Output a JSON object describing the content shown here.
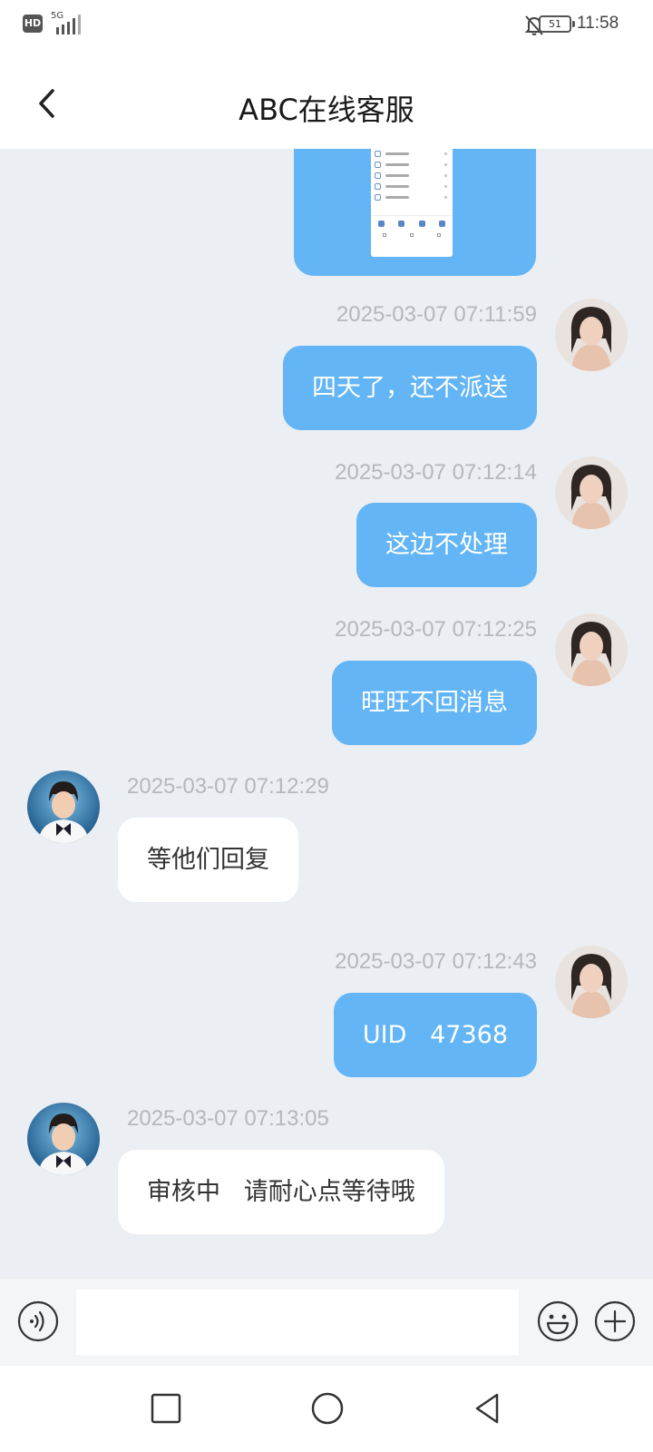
{
  "status_bar": {
    "hd": "HD",
    "network": "5G",
    "battery": "51",
    "time": "11:58"
  },
  "header": {
    "title": "ABC在线客服",
    "back_icon": "chevron-left-icon"
  },
  "messages": [
    {
      "side": "out",
      "kind": "image",
      "description_icon": "screenshot-thumbnail"
    },
    {
      "side": "out",
      "time": "2025-03-07 07:11:59",
      "text": "四天了，还不派送"
    },
    {
      "side": "out",
      "time": "2025-03-07 07:12:14",
      "text": "这边不处理"
    },
    {
      "side": "out",
      "time": "2025-03-07 07:12:25",
      "text": "旺旺不回消息"
    },
    {
      "side": "in",
      "time": "2025-03-07 07:12:29",
      "text": "等他们回复"
    },
    {
      "side": "out",
      "time": "2025-03-07 07:12:43",
      "text": "UID   47368"
    },
    {
      "side": "in",
      "time": "2025-03-07 07:13:05",
      "text": "审核中   请耐心点等待哦"
    }
  ],
  "input_bar": {
    "value": "",
    "voice_icon": "voice-icon",
    "emoji_icon": "emoji-icon",
    "plus_icon": "plus-icon"
  },
  "nav_bar": {
    "recents_icon": "square-icon",
    "home_icon": "circle-icon",
    "back_icon": "triangle-back-icon"
  },
  "colors": {
    "outgoing_bubble": "#63b5f6",
    "incoming_bubble": "#ffffff",
    "chat_background": "#ebeef2",
    "timestamp": "#b5b7bb"
  }
}
